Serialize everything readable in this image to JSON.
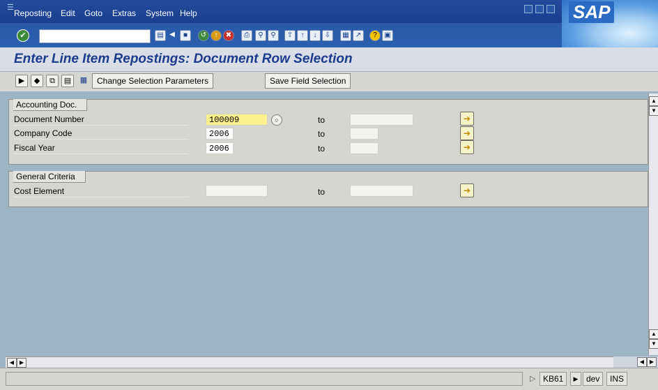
{
  "menu": {
    "items": [
      "Reposting",
      "Edit",
      "Goto",
      "Extras",
      "System",
      "Help"
    ]
  },
  "brand": "SAP",
  "title": "Enter Line Item Repostings: Document Row Selection",
  "app_toolbar": {
    "change_selection_label": "Change Selection Parameters",
    "save_field_label": "Save Field Selection"
  },
  "accounting_doc": {
    "header": "Accounting Doc.",
    "to_label": "to",
    "rows": [
      {
        "label": "Document Number",
        "from": "100009",
        "to": ""
      },
      {
        "label": "Company Code",
        "from": "2006",
        "to": ""
      },
      {
        "label": "Fiscal Year",
        "from": "2006",
        "to": ""
      }
    ]
  },
  "general_criteria": {
    "header": "General Criteria",
    "to_label": "to",
    "rows": [
      {
        "label": "Cost Element",
        "from": "",
        "to": ""
      }
    ]
  },
  "status": {
    "transaction": "KB61",
    "system": "dev",
    "mode": "INS"
  }
}
